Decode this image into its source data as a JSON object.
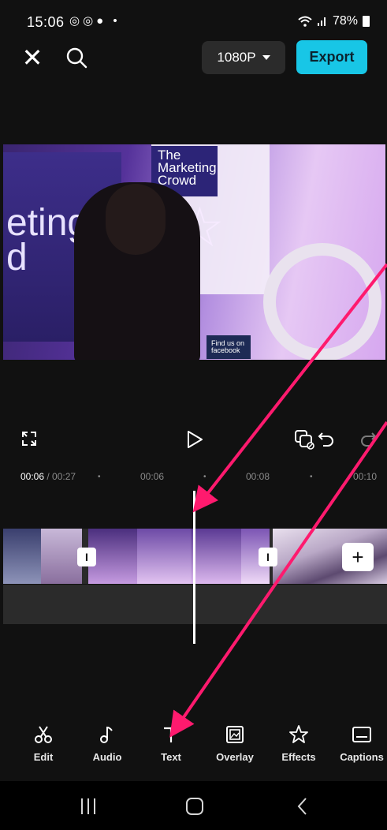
{
  "status_bar": {
    "time": "15:06",
    "left_icons": "◎◎● •",
    "battery": "78%"
  },
  "header": {
    "close_icon": "close-icon",
    "search_icon": "search-icon",
    "resolution_label": "1080P",
    "export_label": "Export"
  },
  "video": {
    "banner_text": "eting\nd",
    "sign_text": "The\nMarketing\nCrowd",
    "fb_text": "Find us on\nfacebook"
  },
  "timeline": {
    "current_time": "00:06",
    "total_time": "/ 00:27",
    "ticks": [
      "00:06",
      "00:08",
      "00:10"
    ]
  },
  "toolbar": {
    "items": [
      {
        "label": "Edit",
        "icon": "scissors-icon"
      },
      {
        "label": "Audio",
        "icon": "music-note-icon"
      },
      {
        "label": "Text",
        "icon": "text-icon"
      },
      {
        "label": "Overlay",
        "icon": "overlay-icon"
      },
      {
        "label": "Effects",
        "icon": "effects-star-icon"
      },
      {
        "label": "Captions",
        "icon": "captions-icon"
      }
    ]
  },
  "colors": {
    "accent": "#18c6e6",
    "arrow": "#ff1a6e",
    "background": "#111111"
  }
}
